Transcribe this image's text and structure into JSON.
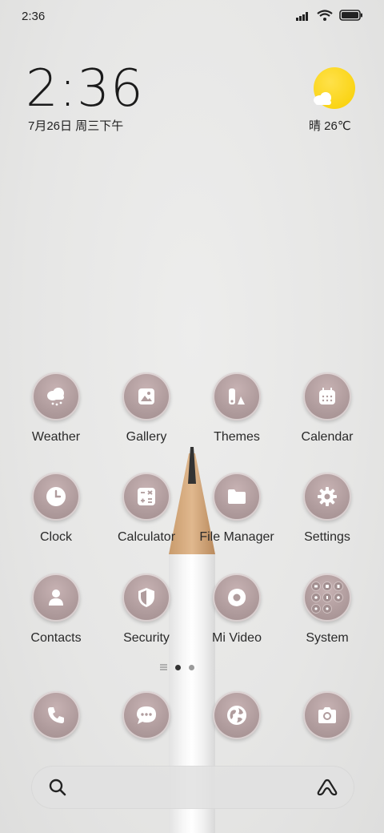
{
  "status_bar": {
    "time": "2:36"
  },
  "clock_widget": {
    "time": "2:36",
    "date": "7月26日 周三下午"
  },
  "weather_widget": {
    "text": "晴 26℃"
  },
  "apps": [
    {
      "label": "Weather"
    },
    {
      "label": "Gallery"
    },
    {
      "label": "Themes"
    },
    {
      "label": "Calendar"
    },
    {
      "label": "Clock"
    },
    {
      "label": "Calculator"
    },
    {
      "label": "File Manager"
    },
    {
      "label": "Settings"
    },
    {
      "label": "Contacts"
    },
    {
      "label": "Security"
    },
    {
      "label": "Mi Video"
    },
    {
      "label": "System"
    }
  ],
  "dock": [
    {
      "icon": "phone-icon"
    },
    {
      "icon": "messages-icon"
    },
    {
      "icon": "browser-icon"
    },
    {
      "icon": "camera-icon"
    }
  ],
  "page_indicator": {
    "pages": 2,
    "active": 1
  },
  "colors": {
    "icon_bg": "#b09c9d",
    "sun": "#f8cf00"
  }
}
